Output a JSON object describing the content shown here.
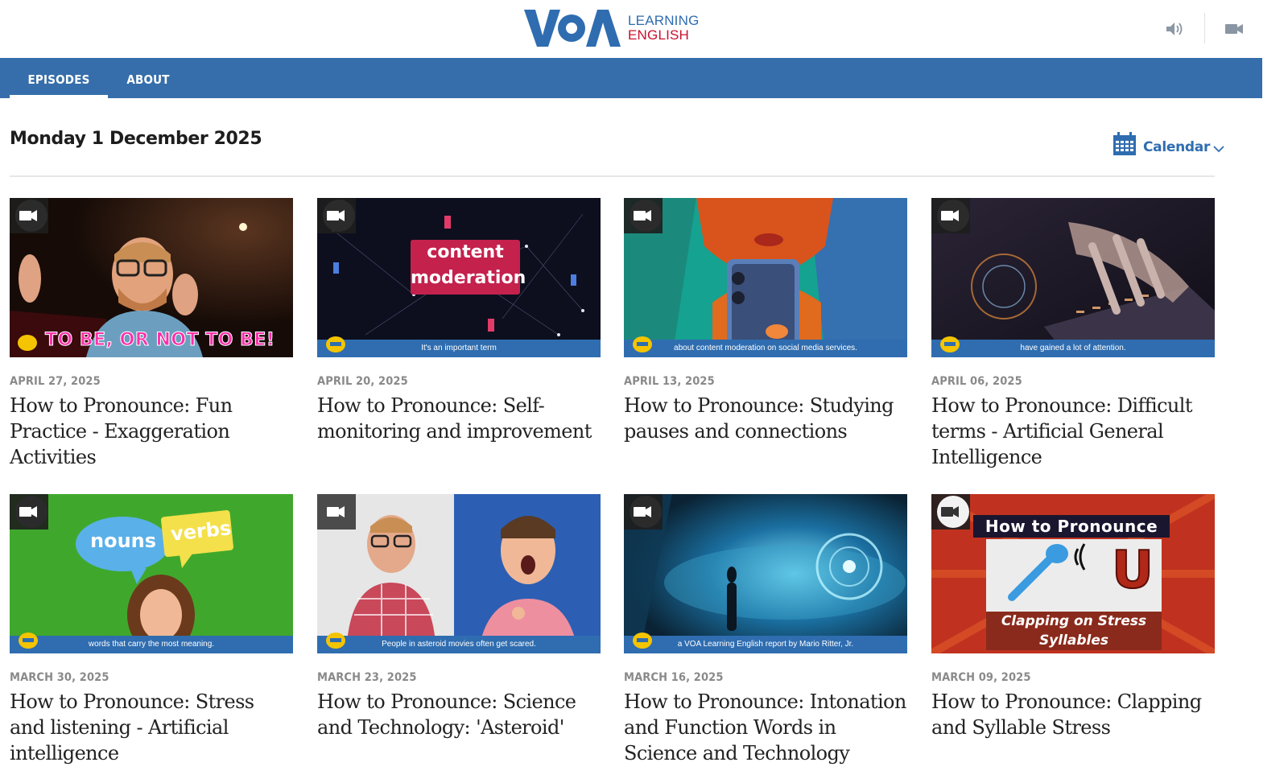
{
  "header": {
    "logo": {
      "mark": "VOA",
      "line1": "LEARNING",
      "line2": "ENGLISH"
    },
    "icons": {
      "audio": "speaker-icon",
      "video": "video-camera-icon"
    }
  },
  "nav": {
    "tabs": [
      {
        "label": "EPISODES",
        "active": true
      },
      {
        "label": "ABOUT",
        "active": false
      }
    ]
  },
  "date_heading": "Monday 1 December 2025",
  "calendar": {
    "label": "Calendar",
    "icon": "calendar-icon"
  },
  "colors": {
    "brand_blue": "#356eaa",
    "link_blue": "#2f6db0",
    "brand_red": "#c8102e"
  },
  "episodes": [
    {
      "date": "APRIL 27, 2025",
      "title": "How to Pronounce: Fun Practice - Exaggeration Activities",
      "thumb_caption": "",
      "thumb_overlay": "TO BE, OR NOT TO BE!"
    },
    {
      "date": "APRIL 20, 2025",
      "title": "How to Pronounce: Self-monitoring and improvement",
      "thumb_caption": "It's an important term",
      "thumb_overlay": "content moderation"
    },
    {
      "date": "APRIL 13, 2025",
      "title": "How to Pronounce: Studying pauses and connections",
      "thumb_caption": "about content moderation on social media services.",
      "thumb_overlay": ""
    },
    {
      "date": "APRIL 06, 2025",
      "title": "How to Pronounce: Difficult terms - Artificial General Intelligence",
      "thumb_caption": "have gained a lot of attention.",
      "thumb_overlay": ""
    },
    {
      "date": "MARCH 30, 2025",
      "title": "How to Pronounce: Stress and listening - Artificial intelligence",
      "thumb_caption": "words that carry the most meaning.",
      "thumb_overlay": "nouns verbs"
    },
    {
      "date": "MARCH 23, 2025",
      "title": "How to Pronounce: Science and Technology: 'Asteroid'",
      "thumb_caption": "People in asteroid movies often get scared.",
      "thumb_overlay": ""
    },
    {
      "date": "MARCH 16, 2025",
      "title": "How to Pronounce: Intonation and Function Words in Science and Technology",
      "thumb_caption": "a VOA Learning English report by Mario Ritter, Jr.",
      "thumb_overlay": ""
    },
    {
      "date": "MARCH 09, 2025",
      "title": "How to Pronounce: Clapping and Syllable Stress",
      "thumb_caption": "",
      "thumb_overlay": "How to Pronounce | Clapping on Stress Syllables"
    }
  ],
  "thumb_texts": {
    "t1_overlay": "TO BE, OR NOT TO BE!",
    "t2_word1": "content",
    "t2_word2": "moderation",
    "t5_word1": "nouns",
    "t5_word2": "verbs",
    "t8_head": "How to Pronounce",
    "t8_line1": "Clapping on Stress",
    "t8_line2": "Syllables",
    "t8_letter": "U"
  }
}
